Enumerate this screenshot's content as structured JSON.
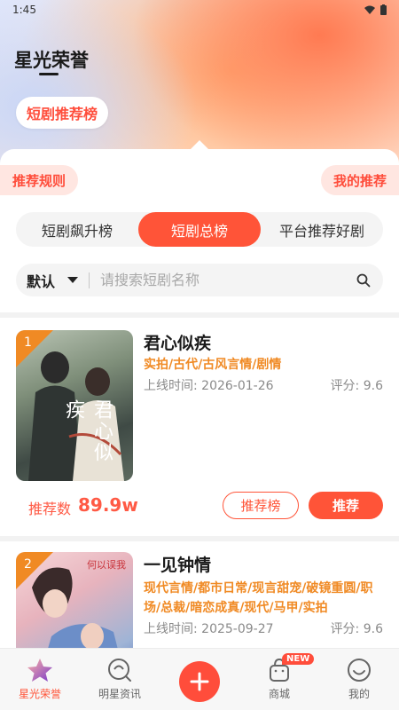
{
  "status_bar": {
    "time": "1:45"
  },
  "header": {
    "title": "星光荣誉",
    "pill": "短剧推荐榜"
  },
  "actions": {
    "rules": "推荐规则",
    "my_recommend": "我的推荐"
  },
  "segments": [
    {
      "label": "短剧飙升榜",
      "active": false
    },
    {
      "label": "短剧总榜",
      "active": true
    },
    {
      "label": "平台推荐好剧",
      "active": false
    }
  ],
  "search": {
    "sort_label": "默认",
    "placeholder": "请搜索短剧名称"
  },
  "dramas": [
    {
      "rank": "1",
      "title": "君心似疾",
      "tags": "实拍/古代/古风言情/剧情",
      "date": "上线时间: 2026-01-26",
      "score": "评分: 9.6",
      "poster_text": "君心似疾",
      "rec_label": "推荐数",
      "rec_value": "89.9w",
      "btn_rank": "推荐榜",
      "btn_rec": "推荐"
    },
    {
      "rank": "2",
      "title": "一见钟情",
      "tags": "现代言情/都市日常/现言甜宠/破镜重圆/职场/总裁/暗恋成真/现代/马甲/实拍",
      "date": "上线时间: 2025-09-27",
      "score": "评分: 9.6",
      "poster_text": "何以误我"
    }
  ],
  "tabbar": [
    {
      "label": "星光荣誉",
      "icon": "star-icon",
      "active": true
    },
    {
      "label": "明星资讯",
      "icon": "news-icon",
      "active": false
    },
    {
      "label": "",
      "icon": "plus-icon",
      "active": false
    },
    {
      "label": "商城",
      "icon": "bag-icon",
      "active": false,
      "badge": "NEW"
    },
    {
      "label": "我的",
      "icon": "face-icon",
      "active": false
    }
  ],
  "colors": {
    "accent": "#ff5438",
    "tag": "#f08a24",
    "soft": "#ffe6e1"
  }
}
